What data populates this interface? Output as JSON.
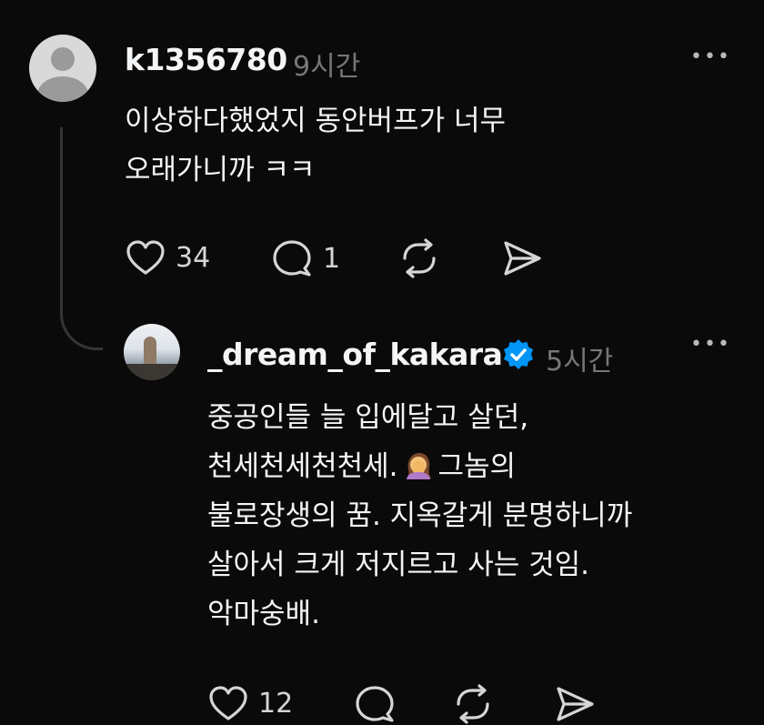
{
  "comment": {
    "username": "k1356780",
    "time": "9시간",
    "avatar_icon": "default-profile-icon",
    "lines": [
      "이상하다했었지 동안버프가 너무",
      "오래가니까 ㅋㅋ"
    ],
    "likes": "34",
    "replies": "1"
  },
  "reply": {
    "username": "_dream_of_kakara",
    "time": "5시간",
    "verified_color": "#0095f6",
    "line1": "중공인들 늘 입에달고 살던,",
    "line2_before": "천세천세천천세.",
    "line2_emoji": "face-palm-emoji",
    "line2_after": "그놈의",
    "line3": "불로장생의 꿈. 지옥갈게 분명하니까",
    "line4": "살아서 크게 저지르고 사는 것임.",
    "line5": "악마숭배.",
    "likes": "12"
  },
  "more_label": "•••"
}
